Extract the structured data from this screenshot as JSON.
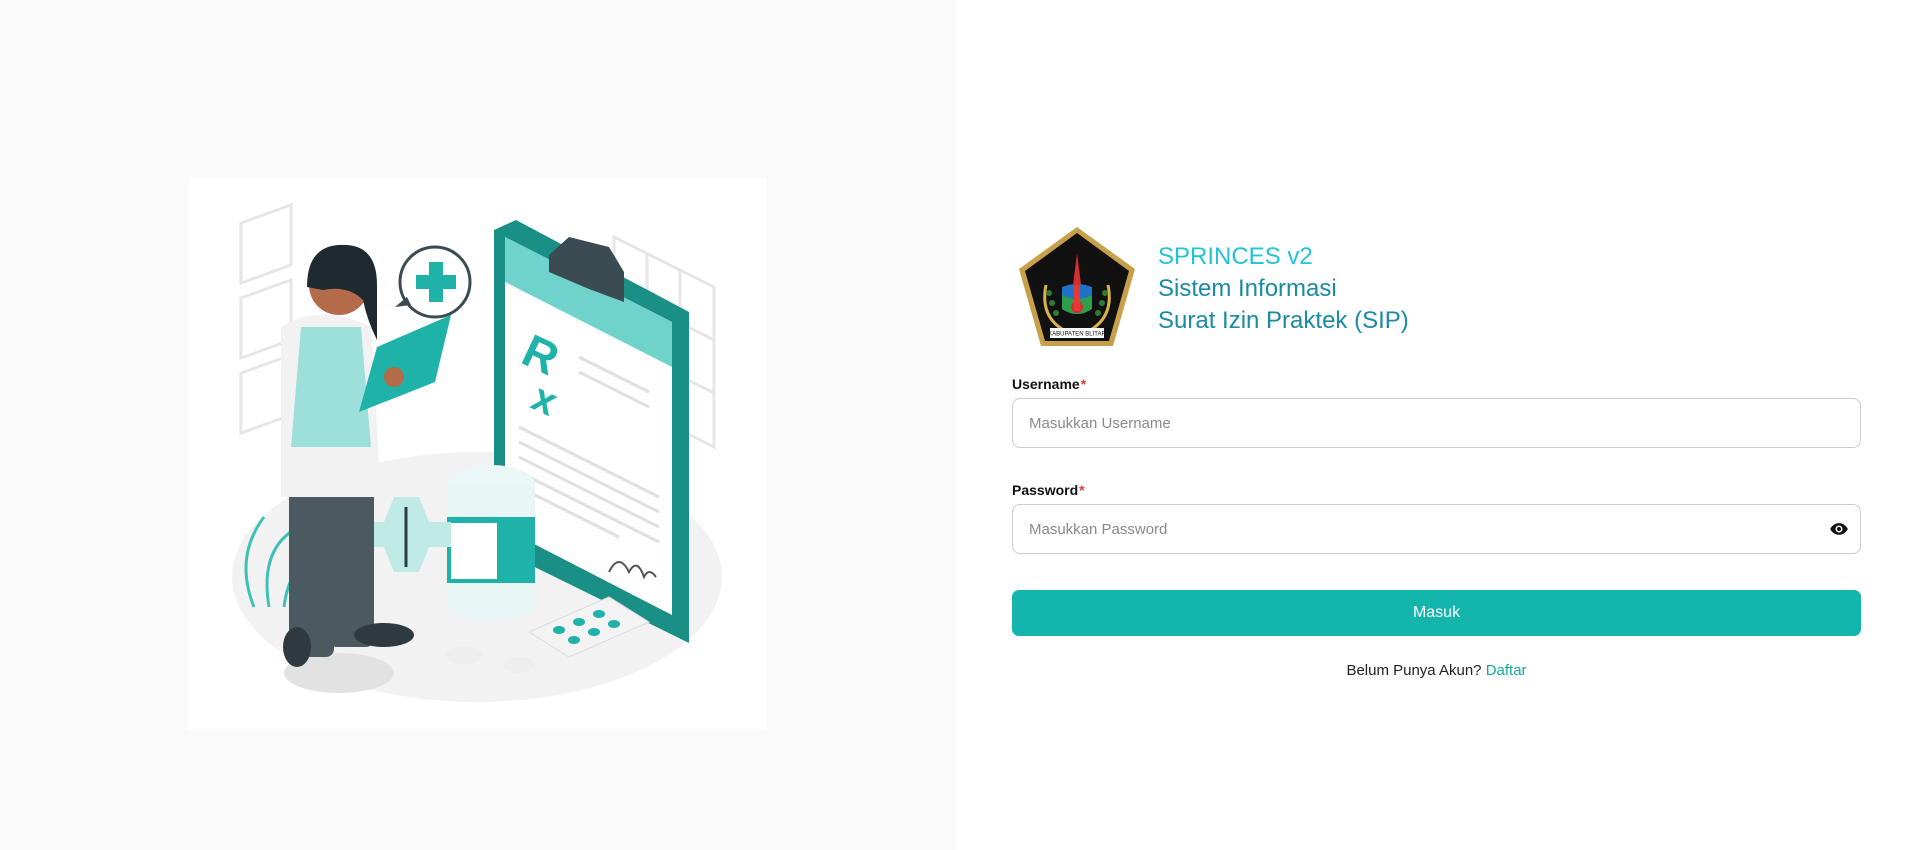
{
  "brand": {
    "product": "SPRINCES v2",
    "line1": "Sistem Informasi",
    "line2": "Surat Izin Praktek (SIP)",
    "logo_caption": "KABUPATEN BLITAR"
  },
  "login": {
    "username_label": "Username",
    "username_placeholder": "Masukkan Username",
    "username_value": "",
    "password_label": "Password",
    "password_placeholder": "Masukkan Password",
    "password_value": "",
    "required_mark": "*",
    "submit_label": "Masuk",
    "register_prompt": "Belum Punya Akun?",
    "register_link": "Daftar"
  },
  "icons": {
    "password_toggle": "eye-icon",
    "illustration": "doctor-prescription-illustration",
    "logo": "kabupaten-blitar-emblem"
  },
  "colors": {
    "accent": "#13b5ad",
    "brand_primary": "#22c3d6",
    "brand_secondary": "#1a8aa6",
    "required": "#e53935"
  }
}
